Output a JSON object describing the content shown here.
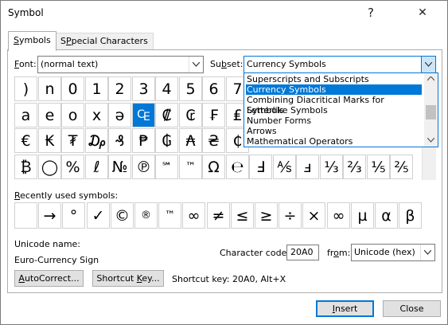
{
  "window": {
    "title": "Symbol",
    "help_glyph": "?",
    "close_glyph": "✕"
  },
  "tabs": [
    {
      "label": "Symbols",
      "accel": "S",
      "rest": "ymbols"
    },
    {
      "label": "Special Characters",
      "accel": "P",
      "rest": "pecial Characters",
      "pre": "S"
    }
  ],
  "font": {
    "label_pre": "",
    "label_accel": "F",
    "label_rest": "ont:",
    "value": "(normal text)"
  },
  "subset": {
    "label_pre": "Su",
    "label_accel": "b",
    "label_rest": "set:",
    "value": "Currency Symbols"
  },
  "subset_options": [
    "Superscripts and Subscripts",
    "Currency Symbols",
    "Combining Diacritical Marks for Symbols",
    "Letterlike Symbols",
    "Number Forms",
    "Arrows",
    "Mathematical Operators"
  ],
  "subset_selected_index": 1,
  "symbol_rows": [
    [
      ")",
      "n",
      "0",
      "1",
      "2",
      "3",
      "4",
      "5",
      "6"
    ],
    [
      "a",
      "e",
      "o",
      "x",
      "ə",
      "₠",
      "₡",
      "₢",
      "₣"
    ],
    [
      "€",
      "₭",
      "₮",
      "₯",
      "₰",
      "₱",
      "₲",
      "₳",
      "₴"
    ],
    [
      "₿",
      "◯",
      "%",
      "ℓ",
      "№",
      "℗",
      "℠",
      "™",
      "Ω",
      "℮",
      "Ⅎ",
      "⅍",
      "ⅎ",
      "⅓",
      "⅔",
      "⅕",
      "⅖"
    ]
  ],
  "symbol_rows_right": [
    [
      "7"
    ],
    [
      "₤"
    ],
    [
      "₵"
    ]
  ],
  "selected_symbol": "₠",
  "recent": {
    "label_pre": "",
    "label_accel": "R",
    "label_rest": "ecently used symbols:",
    "symbols": [
      "",
      "→",
      "°",
      "✓",
      "©",
      "®",
      "™",
      "∞",
      "≠",
      "≤",
      "≥",
      "÷",
      "×",
      "∞",
      "µ",
      "α",
      "β"
    ]
  },
  "unicode_name_label": "Unicode name:",
  "unicode_name_value": "Euro-Currency Sign",
  "char_code": {
    "label_pre": "Character code",
    "label_rest": ":",
    "value": "20A0"
  },
  "from": {
    "label_pre": "fr",
    "label_accel": "o",
    "label_rest": "m:",
    "value": "Unicode (hex)"
  },
  "buttons": {
    "autocorrect": {
      "accel": "A",
      "rest": "utoCorrect..."
    },
    "shortcut_key": {
      "pre": "Shortcut ",
      "accel": "K",
      "rest": "ey..."
    },
    "insert": {
      "accel": "I",
      "rest": "nsert"
    },
    "close": "Close"
  },
  "shortcut_text": "Shortcut key: 20A0, Alt+X"
}
